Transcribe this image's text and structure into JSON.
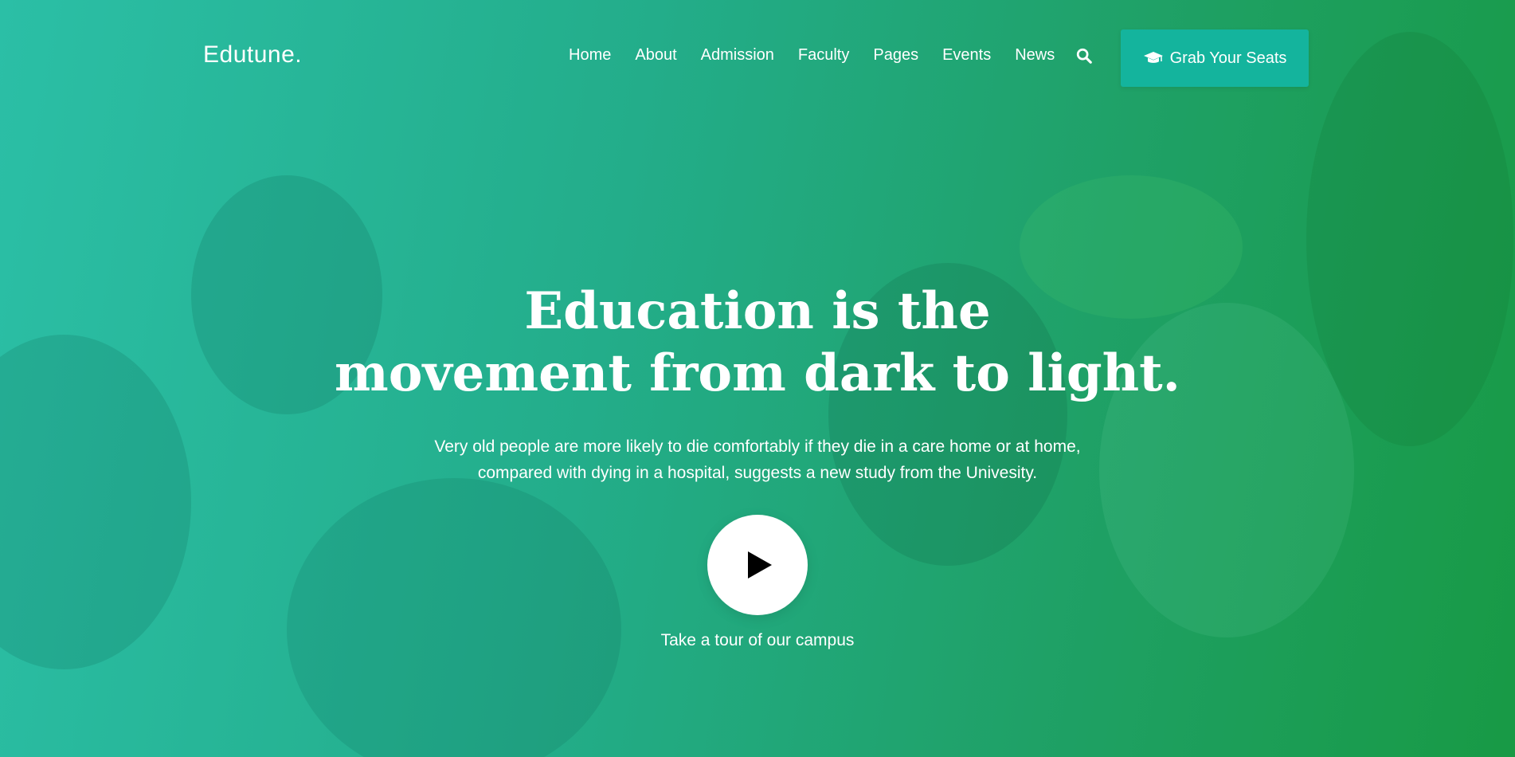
{
  "brand": {
    "logo_text": "Edutune."
  },
  "nav": {
    "items": [
      {
        "label": "Home"
      },
      {
        "label": "About"
      },
      {
        "label": "Admission"
      },
      {
        "label": "Faculty"
      },
      {
        "label": "Pages"
      },
      {
        "label": "Events"
      },
      {
        "label": "News"
      }
    ],
    "search_icon": "search-icon"
  },
  "cta": {
    "label": "Grab Your Seats",
    "icon": "graduation-cap-icon",
    "color": "#14b49d"
  },
  "hero": {
    "headline_line1": "Education is the",
    "headline_line2": "movement from dark to light.",
    "subtext_line1": "Very old people are more likely to die comfortably if they die in a care home or at home,",
    "subtext_line2": "compared with dying in a hospital, suggests a new study from the Univesity.",
    "play_icon": "play-icon",
    "tour_label": "Take a tour of our campus"
  },
  "colors": {
    "gradient_start": "#2bbfa6",
    "gradient_end": "#189a45",
    "text": "#ffffff"
  }
}
